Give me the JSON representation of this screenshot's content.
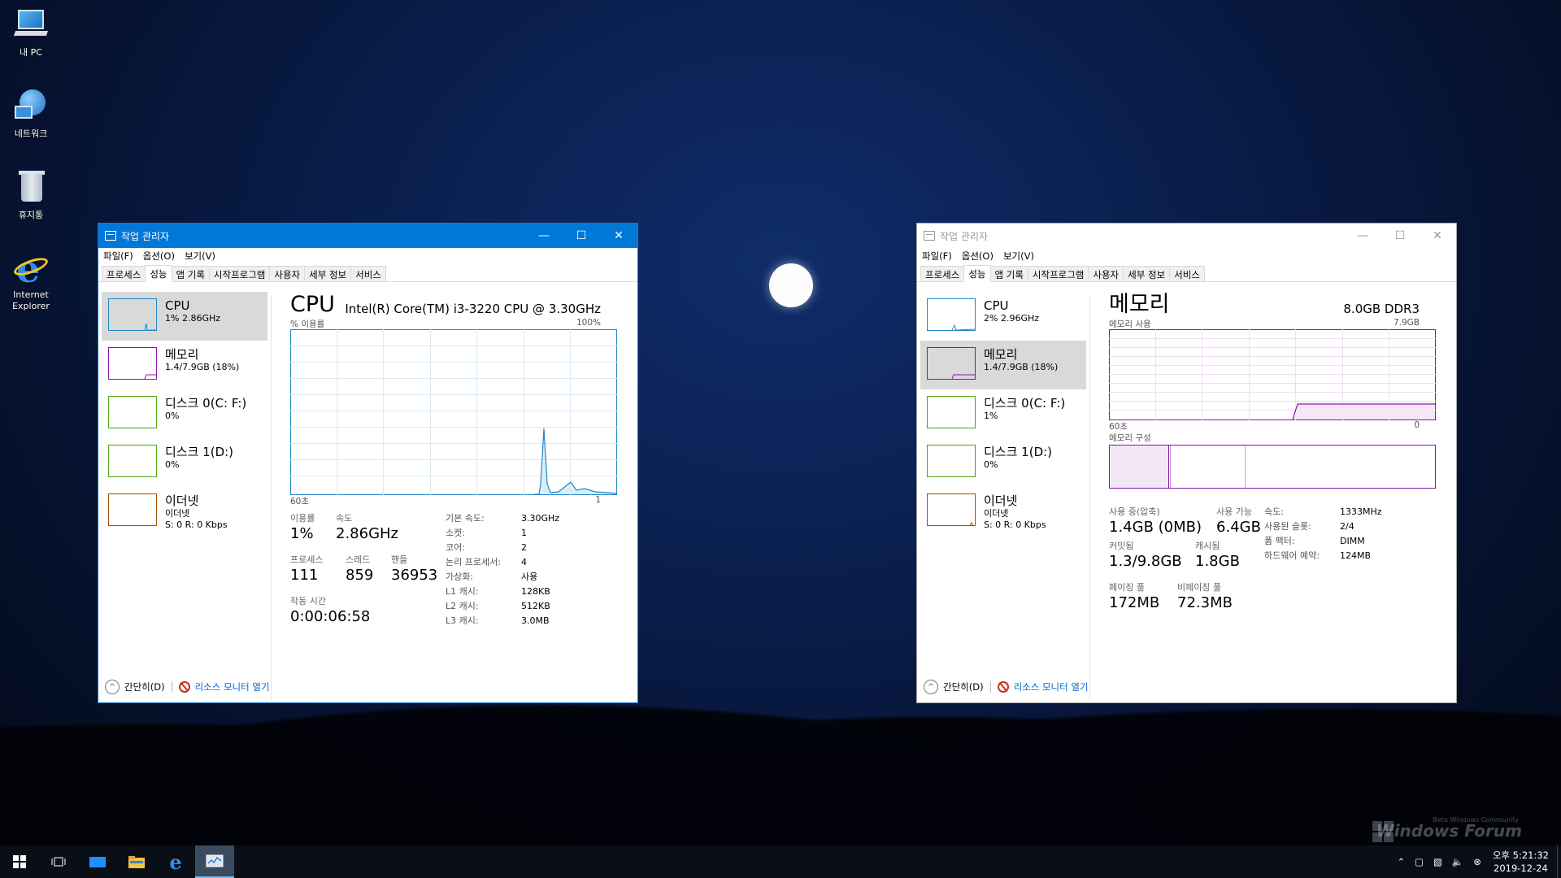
{
  "desktop": {
    "icons": [
      {
        "label": "내 PC"
      },
      {
        "label": "네트워크"
      },
      {
        "label": "휴지통"
      },
      {
        "label": "Internet Explorer"
      }
    ],
    "watermark_small": "Beta Windows Community",
    "watermark": "Windows Forum"
  },
  "window_left": {
    "title": "작업 관리자",
    "menu": [
      "파일(F)",
      "옵션(O)",
      "보기(V)"
    ],
    "tabs": [
      "프로세스",
      "성능",
      "앱 기록",
      "시작프로그램",
      "사용자",
      "세부 정보",
      "서비스"
    ],
    "active_tab": "성능",
    "sidebar": [
      {
        "name": "CPU",
        "sub": "1% 2.86GHz",
        "color": "#1f88c6"
      },
      {
        "name": "메모리",
        "sub": "1.4/7.9GB (18%)",
        "color": "#8b12ae"
      },
      {
        "name": "디스크 0(C: F:)",
        "sub": "0%",
        "color": "#4da60c"
      },
      {
        "name": "디스크 1(D:)",
        "sub": "0%",
        "color": "#4da60c"
      },
      {
        "name": "이더넷",
        "sub": "이더넷",
        "sub2": "S: 0 R: 0 Kbps",
        "color": "#a74f01"
      }
    ],
    "selected_index": 0,
    "heading": "CPU",
    "model": "Intel(R) Core(TM) i3-3220 CPU @ 3.30GHz",
    "graph": {
      "top_left": "% 이용률",
      "top_right": "100%",
      "bottom_left": "60초",
      "bottom_right": "1"
    },
    "stats": {
      "util_label": "이용률",
      "util": "1%",
      "speed_label": "속도",
      "speed": "2.86GHz",
      "proc_label": "프로세스",
      "proc": "111",
      "thread_label": "스레드",
      "thread": "859",
      "handle_label": "핸들",
      "handle": "36953",
      "uptime_label": "작동 시간",
      "uptime": "0:00:06:58"
    },
    "details": [
      {
        "k": "기본 속도:",
        "v": "3.30GHz"
      },
      {
        "k": "소켓:",
        "v": "1"
      },
      {
        "k": "코어:",
        "v": "2"
      },
      {
        "k": "논리 프로세서:",
        "v": "4"
      },
      {
        "k": "가상화:",
        "v": "사용"
      },
      {
        "k": "L1 캐시:",
        "v": "128KB"
      },
      {
        "k": "L2 캐시:",
        "v": "512KB"
      },
      {
        "k": "L3 캐시:",
        "v": "3.0MB"
      }
    ],
    "footer": {
      "less": "간단히(D)",
      "monitor": "리소스 모니터 열기"
    }
  },
  "window_right": {
    "title": "작업 관리자",
    "menu": [
      "파일(F)",
      "옵션(O)",
      "보기(V)"
    ],
    "tabs": [
      "프로세스",
      "성능",
      "앱 기록",
      "시작프로그램",
      "사용자",
      "세부 정보",
      "서비스"
    ],
    "sidebar": [
      {
        "name": "CPU",
        "sub": "2% 2.96GHz"
      },
      {
        "name": "메모리",
        "sub": "1.4/7.9GB (18%)"
      },
      {
        "name": "디스크 0(C: F:)",
        "sub": "1%"
      },
      {
        "name": "디스크 1(D:)",
        "sub": "0%"
      },
      {
        "name": "이더넷",
        "sub": "이더넷",
        "sub2": "S: 0 R: 0 Kbps"
      }
    ],
    "selected_index": 1,
    "heading": "메모리",
    "model": "8.0GB DDR3",
    "graph": {
      "top_left": "메모리 사용",
      "top_right": "7.9GB",
      "bottom_left": "60초",
      "bottom_right": "0"
    },
    "composition_label": "메모리 구성",
    "stats": {
      "inuse_label": "사용 중(압축)",
      "inuse": "1.4GB (0MB)",
      "avail_label": "사용 가능",
      "avail": "6.4GB",
      "commit_label": "커밋됨",
      "commit": "1.3/9.8GB",
      "cached_label": "캐시됨",
      "cached": "1.8GB",
      "paged_label": "페이징 풀",
      "paged": "172MB",
      "nonpaged_label": "비페이징 풀",
      "nonpaged": "72.3MB"
    },
    "details": [
      {
        "k": "속도:",
        "v": "1333MHz"
      },
      {
        "k": "사용된 슬롯:",
        "v": "2/4"
      },
      {
        "k": "폼 팩터:",
        "v": "DIMM"
      },
      {
        "k": "하드웨어 예약:",
        "v": "124MB"
      }
    ],
    "footer": {
      "less": "간단히(D)",
      "monitor": "리소스 모니터 열기"
    }
  },
  "taskbar": {
    "clock_time": "오후 5:21:32",
    "clock_date": "2019-12-24"
  }
}
